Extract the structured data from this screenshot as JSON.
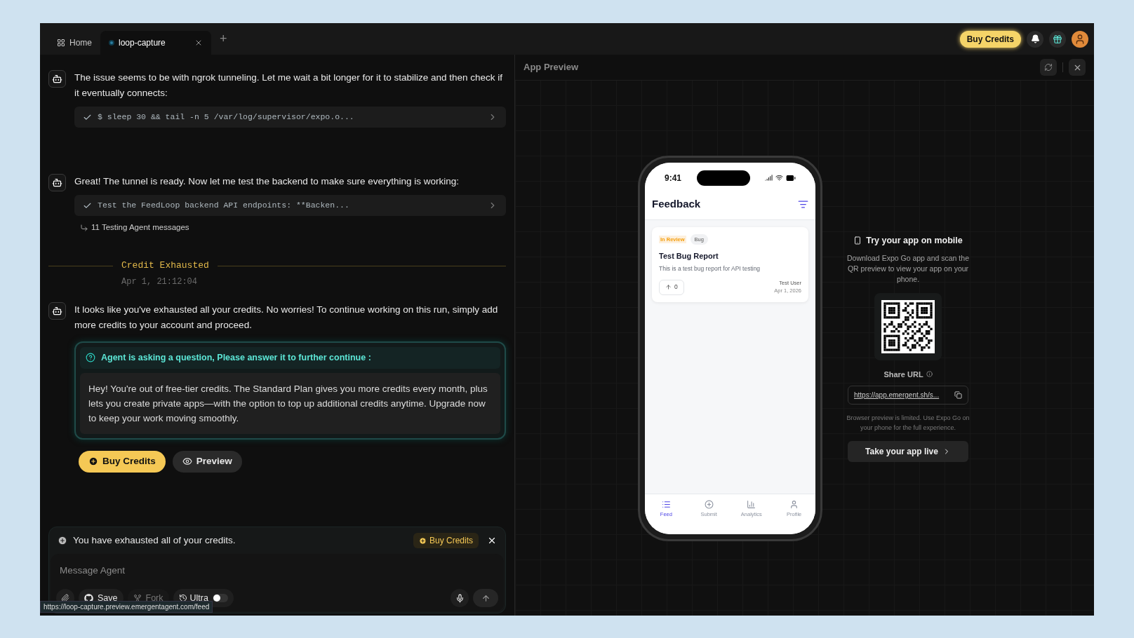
{
  "tabs": [
    {
      "label": "Home",
      "kind": "home",
      "selected": false
    },
    {
      "label": "loop-capture",
      "kind": "project",
      "selected": true
    }
  ],
  "new_tab": "+",
  "header": {
    "buy_credits": "Buy Credits"
  },
  "chat": {
    "messages": [
      {
        "kind": "agent",
        "text": "The issue seems to be with ngrok tunneling. Let me wait a bit longer for it to stabilize and then check if it eventually connects:",
        "tools": [
          "$ sleep 30 && tail -n 5 /var/log/supervisor/expo.o..."
        ]
      },
      {
        "kind": "agent",
        "text": "Great! The tunnel is ready. Now let me test the backend to make sure everything is working:",
        "tools": [
          "Test the FeedLoop backend API endpoints: **Backen..."
        ],
        "thread": "11 Testing Agent messages"
      },
      {
        "kind": "divider",
        "title": "Credit Exhausted",
        "time": "Apr 1, 21:12:04"
      },
      {
        "kind": "agent",
        "text": "It looks like you've exhausted all your credits. No worries! To continue working on this run, simply add more credits to your account and proceed.",
        "question": {
          "title": "Agent is asking a question, Please answer it to further continue :",
          "body": "Hey! You're out of free-tier credits. The Standard Plan gives you more credits every month, plus lets you create private apps—with the option to top up additional credits anytime. Upgrade now to keep your work moving smoothly."
        },
        "actions": [
          {
            "label": "Buy Credits",
            "kind": "primary"
          },
          {
            "label": "Preview",
            "kind": "secondary"
          }
        ]
      }
    ]
  },
  "composer": {
    "banner": "You have exhausted all of your credits.",
    "banner_button": "Buy Credits",
    "placeholder": "Message Agent",
    "tools": [
      {
        "label": "Save",
        "kind": "github",
        "disabled": false
      },
      {
        "label": "Fork",
        "kind": "fork",
        "disabled": true
      },
      {
        "label": "Ultra",
        "kind": "toggle",
        "disabled": false,
        "on": false
      }
    ]
  },
  "status_url": "https://loop-capture.preview.emergentagent.com/feed",
  "preview": {
    "title": "App Preview",
    "phone": {
      "time": "9:41",
      "title": "Feedback",
      "card": {
        "status": "In Review",
        "tag": "Bug",
        "title": "Test Bug Report",
        "description": "This is a test bug report for API testing",
        "votes": "0",
        "author": "Test User",
        "date": "Apr 1, 2026"
      },
      "nav": [
        {
          "label": "Feed",
          "kind": "list",
          "selected": true
        },
        {
          "label": "Submit",
          "kind": "plus",
          "selected": false
        },
        {
          "label": "Analytics",
          "kind": "chart",
          "selected": false
        },
        {
          "label": "Profile",
          "kind": "person",
          "selected": false
        }
      ]
    },
    "mobile": {
      "heading": "Try your app on mobile",
      "description": "Download Expo Go app and scan the QR preview to view your app on your phone.",
      "share_label": "Share URL",
      "url": "https://app.emergent.sh/s...",
      "note": "Browser preview is limited. Use Expo Go on your phone for the full experience.",
      "cta": "Take your app live"
    }
  }
}
